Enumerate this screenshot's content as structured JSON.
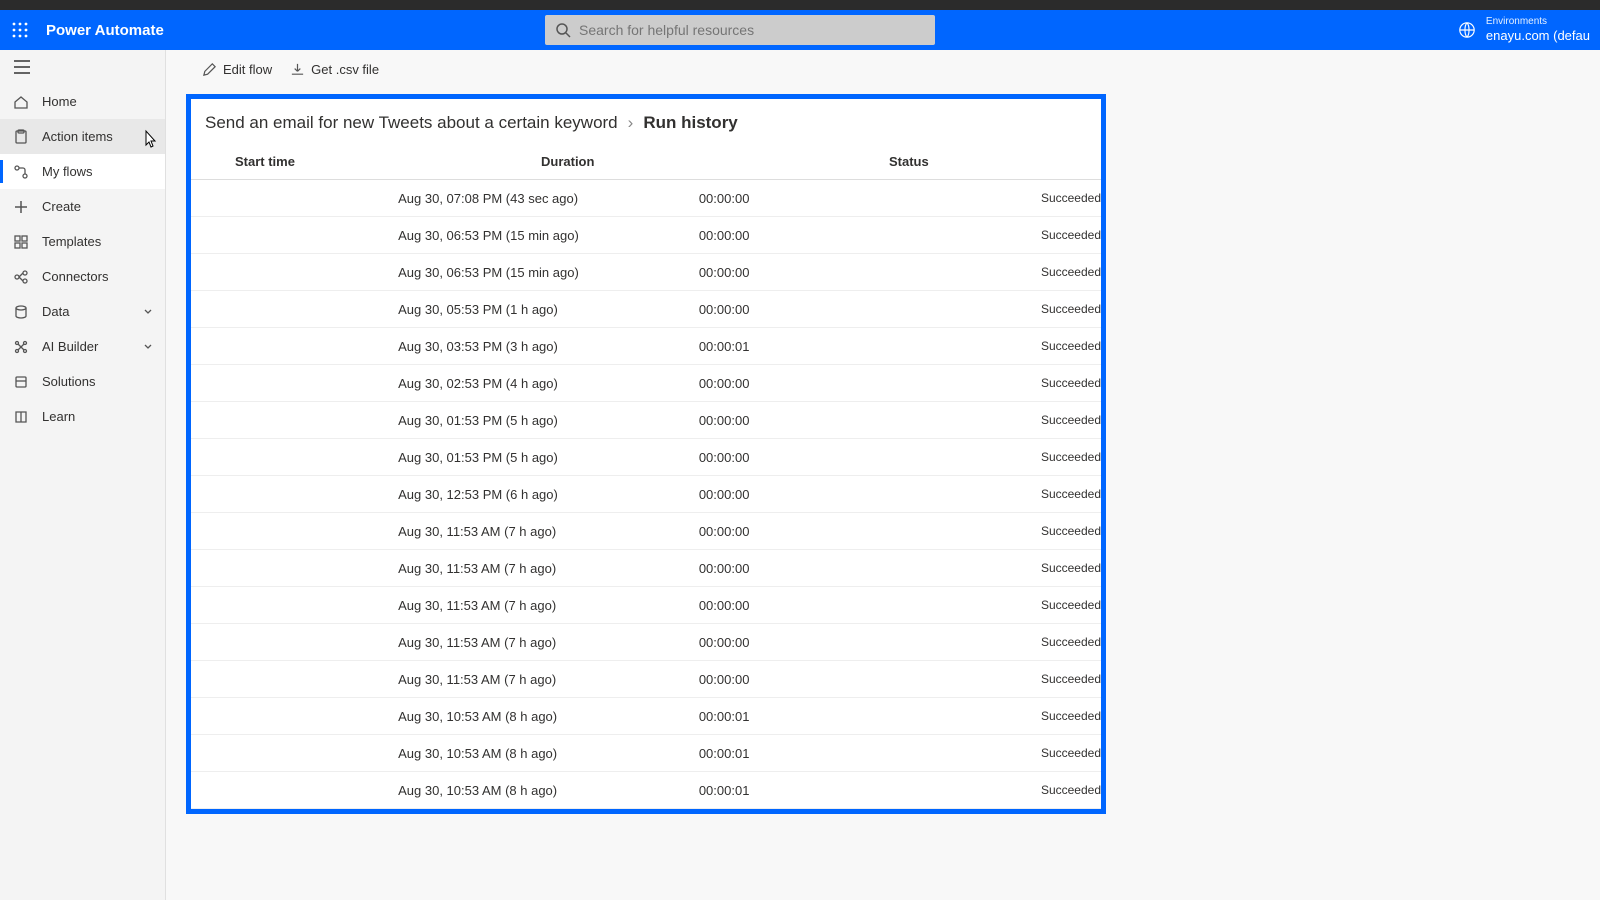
{
  "header": {
    "brand": "Power Automate",
    "search_placeholder": "Search for helpful resources",
    "env_label": "Environments",
    "env_value": "enayu.com (defau"
  },
  "sidebar": {
    "items": [
      {
        "label": "Home",
        "icon": "home"
      },
      {
        "label": "Action items",
        "icon": "clipboard",
        "hover": true
      },
      {
        "label": "My flows",
        "icon": "flow",
        "active": true
      },
      {
        "label": "Create",
        "icon": "plus"
      },
      {
        "label": "Templates",
        "icon": "template"
      },
      {
        "label": "Connectors",
        "icon": "connector"
      },
      {
        "label": "Data",
        "icon": "data",
        "chevron": true
      },
      {
        "label": "AI Builder",
        "icon": "ai",
        "chevron": true
      },
      {
        "label": "Solutions",
        "icon": "solutions"
      },
      {
        "label": "Learn",
        "icon": "book"
      }
    ]
  },
  "toolbar": {
    "edit_label": "Edit flow",
    "csv_label": "Get .csv file"
  },
  "breadcrumb": {
    "flow_name": "Send an email for new Tweets about a certain keyword",
    "current": "Run history"
  },
  "table": {
    "headers": {
      "start": "Start time",
      "duration": "Duration",
      "status": "Status"
    },
    "rows": [
      {
        "start": "Aug 30, 07:08 PM (43 sec ago)",
        "duration": "00:00:00",
        "status": "Succeeded"
      },
      {
        "start": "Aug 30, 06:53 PM (15 min ago)",
        "duration": "00:00:00",
        "status": "Succeeded"
      },
      {
        "start": "Aug 30, 06:53 PM (15 min ago)",
        "duration": "00:00:00",
        "status": "Succeeded"
      },
      {
        "start": "Aug 30, 05:53 PM (1 h ago)",
        "duration": "00:00:00",
        "status": "Succeeded"
      },
      {
        "start": "Aug 30, 03:53 PM (3 h ago)",
        "duration": "00:00:01",
        "status": "Succeeded"
      },
      {
        "start": "Aug 30, 02:53 PM (4 h ago)",
        "duration": "00:00:00",
        "status": "Succeeded"
      },
      {
        "start": "Aug 30, 01:53 PM (5 h ago)",
        "duration": "00:00:00",
        "status": "Succeeded"
      },
      {
        "start": "Aug 30, 01:53 PM (5 h ago)",
        "duration": "00:00:00",
        "status": "Succeeded"
      },
      {
        "start": "Aug 30, 12:53 PM (6 h ago)",
        "duration": "00:00:00",
        "status": "Succeeded"
      },
      {
        "start": "Aug 30, 11:53 AM (7 h ago)",
        "duration": "00:00:00",
        "status": "Succeeded"
      },
      {
        "start": "Aug 30, 11:53 AM (7 h ago)",
        "duration": "00:00:00",
        "status": "Succeeded"
      },
      {
        "start": "Aug 30, 11:53 AM (7 h ago)",
        "duration": "00:00:00",
        "status": "Succeeded"
      },
      {
        "start": "Aug 30, 11:53 AM (7 h ago)",
        "duration": "00:00:00",
        "status": "Succeeded"
      },
      {
        "start": "Aug 30, 11:53 AM (7 h ago)",
        "duration": "00:00:00",
        "status": "Succeeded"
      },
      {
        "start": "Aug 30, 10:53 AM (8 h ago)",
        "duration": "00:00:01",
        "status": "Succeeded"
      },
      {
        "start": "Aug 30, 10:53 AM (8 h ago)",
        "duration": "00:00:01",
        "status": "Succeeded"
      },
      {
        "start": "Aug 30, 10:53 AM (8 h ago)",
        "duration": "00:00:01",
        "status": "Succeeded"
      }
    ]
  }
}
